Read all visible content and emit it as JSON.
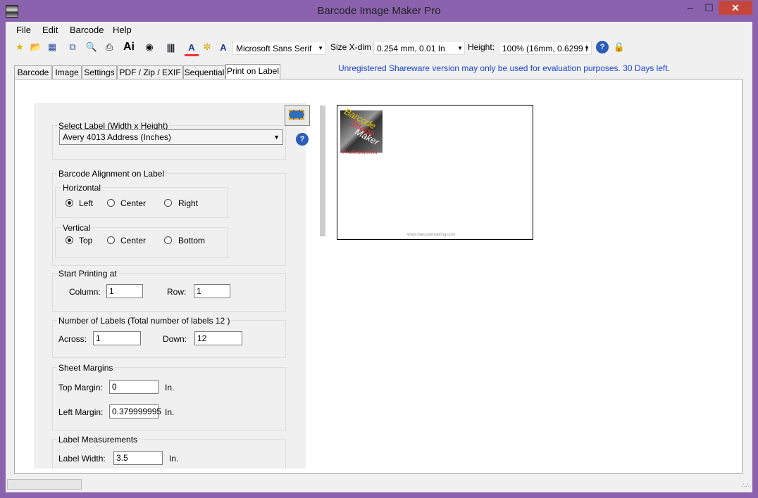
{
  "window": {
    "title": "Barcode Image Maker Pro"
  },
  "menu": [
    "File",
    "Edit",
    "Barcode",
    "Help"
  ],
  "toolbar": {
    "font": "Microsoft Sans Serif",
    "size_label": "Size X-dim",
    "size_value": "0.254 mm, 0.01 In",
    "height_label": "Height:",
    "height_value": "100% (16mm, 0.6299 I",
    "ai_label": "Ai"
  },
  "tabs": [
    "Barcode",
    "Image",
    "Settings",
    "PDF / Zip / EXIF",
    "Sequential",
    "Print on Label"
  ],
  "shareware_notice": "Unregistered Shareware version may only be used for evaluation purposes. 30 Days left.",
  "select_label": {
    "title": "Select Label  (Width x Height)",
    "value": "Avery 4013 Address (Inches)"
  },
  "alignment": {
    "title": "Barcode Alignment on Label",
    "horizontal": {
      "title": "Horizontal",
      "options": [
        "Left",
        "Center",
        "Right"
      ],
      "selected": "Left"
    },
    "vertical": {
      "title": "Vertical",
      "options": [
        "Top",
        "Center",
        "Bottom"
      ],
      "selected": "Top"
    }
  },
  "start_printing": {
    "title": "Start Printing at",
    "column_label": "Column:",
    "column_value": "1",
    "row_label": "Row:",
    "row_value": "1"
  },
  "number_of_labels": {
    "title": "Number of Labels (Total number of labels 12 )",
    "across_label": "Across:",
    "across_value": "1",
    "down_label": "Down:",
    "down_value": "12"
  },
  "sheet_margins": {
    "title": "Sheet Margins",
    "top_label": "Top Margin:",
    "top_value": "0",
    "left_label": "Left Margin:",
    "left_value": "0.379999995",
    "unit": "In."
  },
  "label_measurements": {
    "title": "Label Measurements",
    "width_label": "Label Width:",
    "width_value": "3.5",
    "unit": "In."
  },
  "preview": {
    "logo_lines": [
      "Barcode",
      "Image",
      "Maker"
    ],
    "logo_sub": "Professional",
    "website": "www.barcodemaking.com"
  }
}
